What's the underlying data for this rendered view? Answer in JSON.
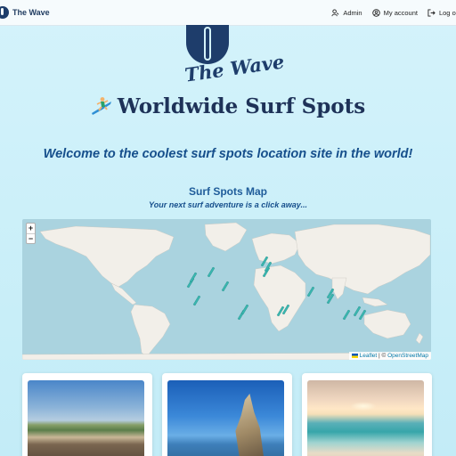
{
  "navbar": {
    "brand": "The Wave",
    "links": [
      {
        "label": "Admin",
        "icon": "admin-icon"
      },
      {
        "label": "My account",
        "icon": "account-icon"
      },
      {
        "label": "Log out",
        "icon": "logout-icon"
      }
    ]
  },
  "hero": {
    "logo_text": "The Wave",
    "title": "Worldwide Surf Spots",
    "title_icon": "surfer-emoji",
    "welcome": "Welcome to the coolest surf spots location site in the world!"
  },
  "map_section": {
    "heading": "Surf Spots Map",
    "subheading": "Your next surf adventure is a click away...",
    "zoom_in": "+",
    "zoom_out": "−",
    "attribution_leaflet": "Leaflet",
    "attribution_sep": " | © ",
    "attribution_osm": "OpenStreetMap",
    "marker_icon": "surfboard-marker-icon",
    "colors": {
      "sea": "#aad3df",
      "land": "#f2efe9",
      "marker": "#3ab7b0"
    }
  },
  "cards": [
    {
      "image": "coastal-beach-photo"
    },
    {
      "image": "rock-formation-photo"
    },
    {
      "image": "sunset-beach-photo"
    }
  ],
  "colors": {
    "title": "#1e3258",
    "welcome": "#164f8c",
    "heading": "#1f5c9a",
    "background": "#c3ecf7"
  }
}
